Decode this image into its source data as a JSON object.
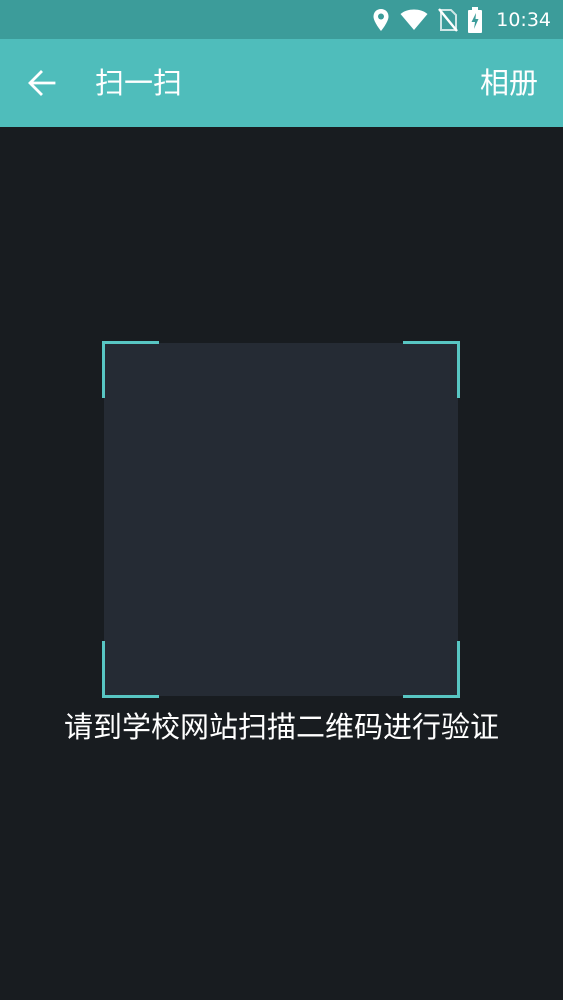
{
  "status_bar": {
    "time": "10:34",
    "icons": [
      "location-pin-icon",
      "wifi-icon",
      "no-sim-icon",
      "battery-charging-icon"
    ]
  },
  "toolbar": {
    "back_icon": "arrow-left-icon",
    "title": "扫一扫",
    "album_label": "相册"
  },
  "scanner": {
    "hint": "请到学校网站扫描二维码进行验证"
  },
  "colors": {
    "status_bar_bg": "#3c9c9a",
    "toolbar_bg": "#4fbdbb",
    "background": "#181c20",
    "scan_frame_bg": "#252b34",
    "corner_accent": "#58c6c3"
  }
}
